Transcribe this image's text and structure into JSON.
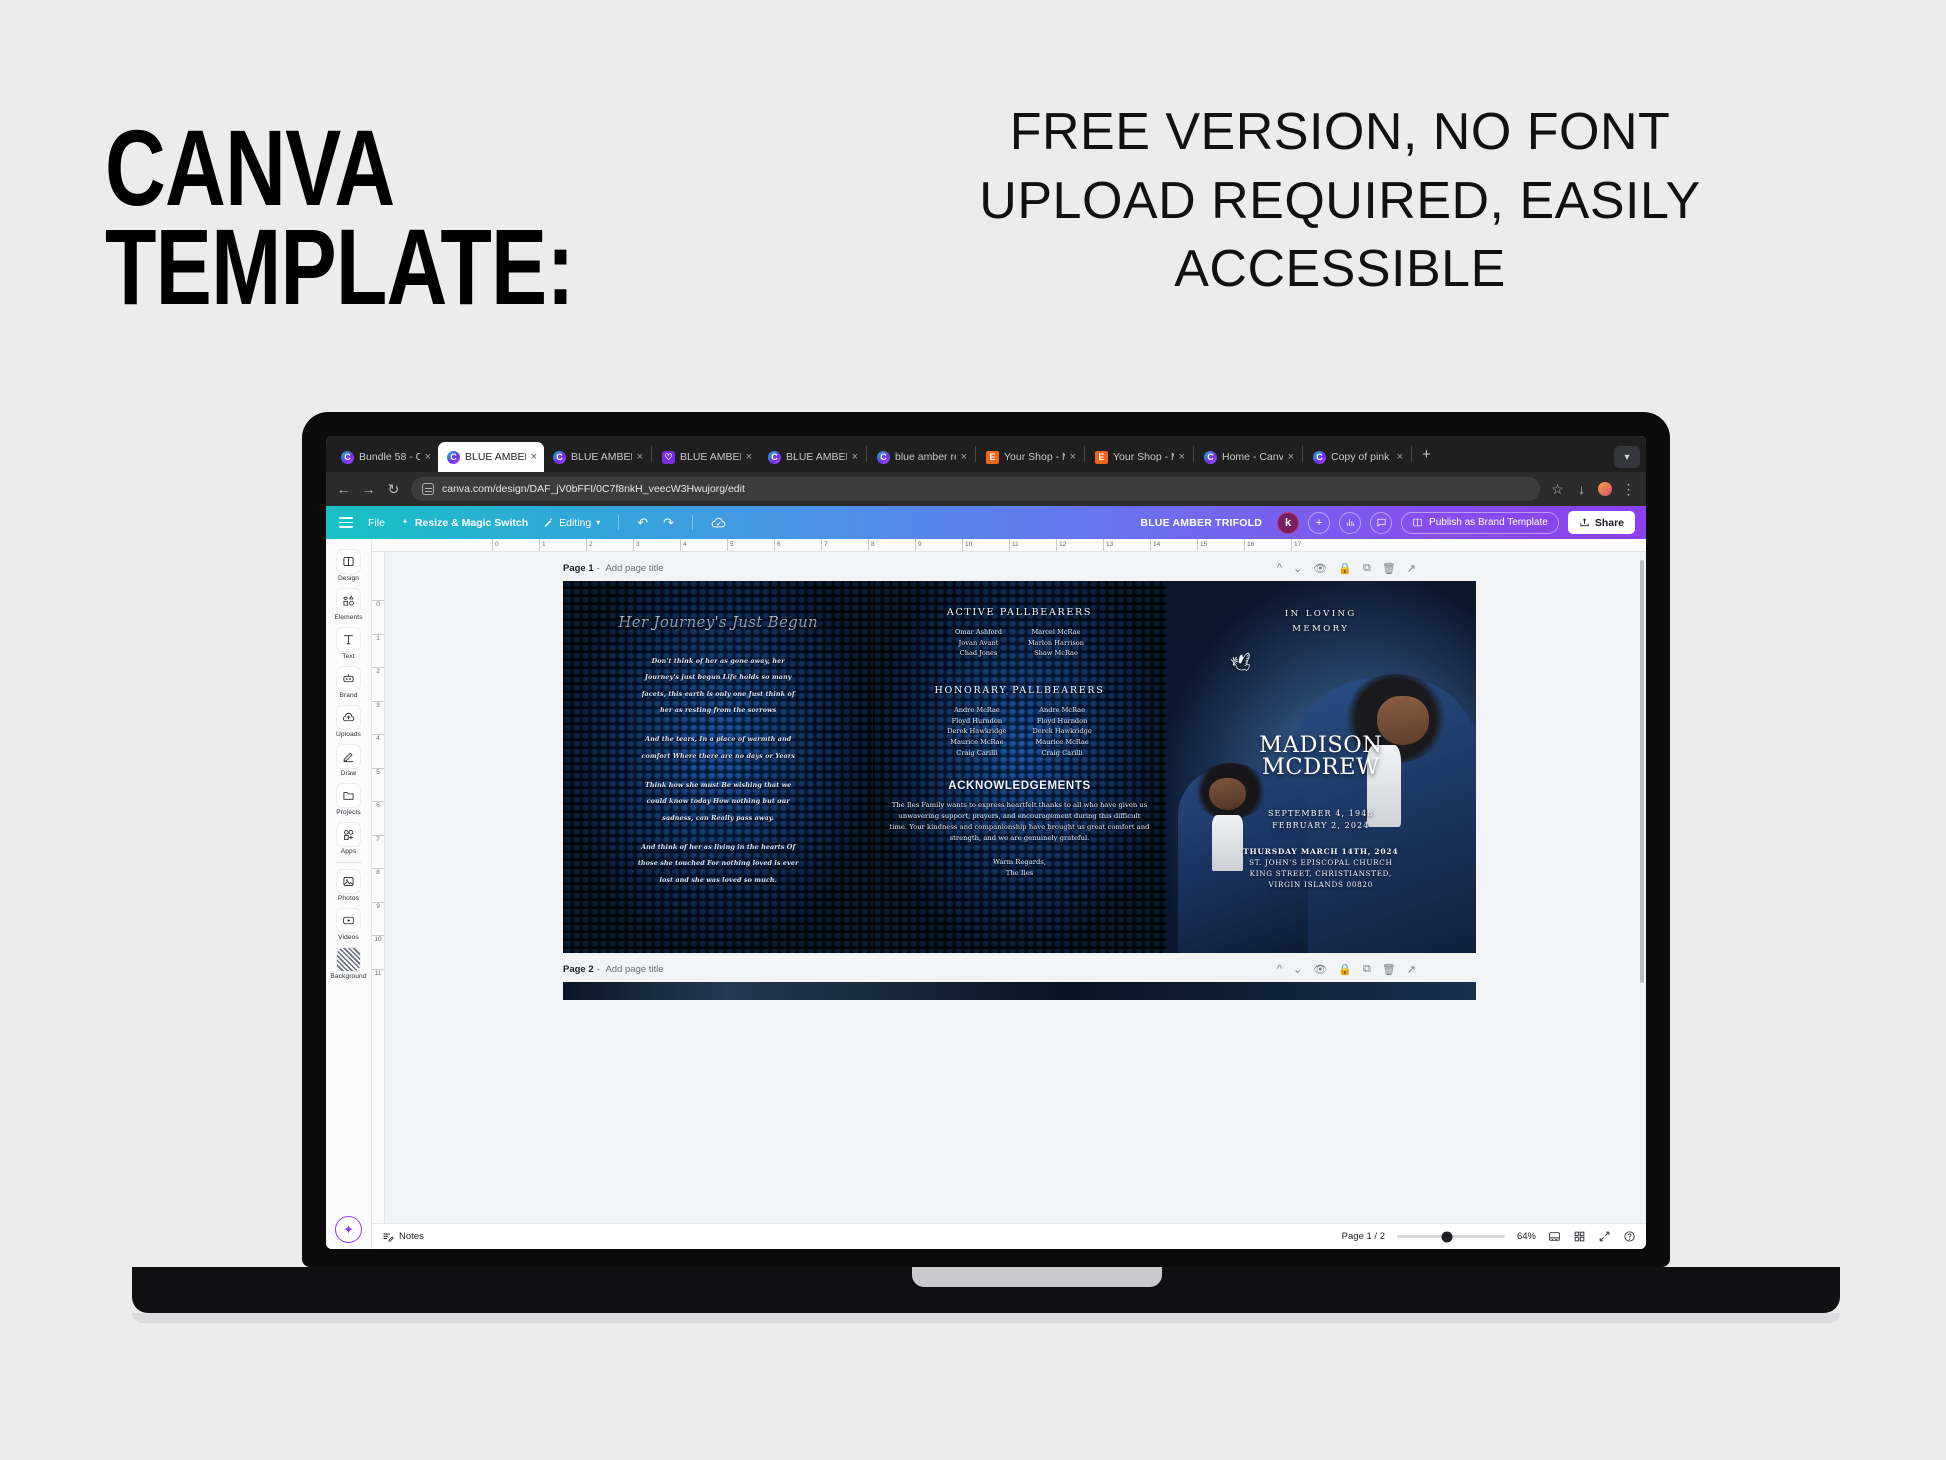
{
  "promo": {
    "headline": "CANVA TEMPLATE:",
    "subheadline": "FREE VERSION, NO FONT UPLOAD REQUIRED, EASILY ACCESSIBLE"
  },
  "browser": {
    "tabs": [
      {
        "title": "Bundle 58 - C",
        "favicon": "canva-icon",
        "active": false
      },
      {
        "title": "BLUE AMBER T",
        "favicon": "canva-icon",
        "active": true
      },
      {
        "title": "BLUE AMBER",
        "favicon": "canva-icon",
        "active": false
      },
      {
        "title": "BLUE AMBER",
        "favicon": "bookmark-icon",
        "active": false
      },
      {
        "title": "BLUE AMBER",
        "favicon": "canva-icon",
        "active": false
      },
      {
        "title": "blue amber re",
        "favicon": "canva-icon",
        "active": false
      },
      {
        "title": "Your Shop - M",
        "favicon": "etsy-icon",
        "active": false
      },
      {
        "title": "Your Shop - M",
        "favicon": "etsy-icon",
        "active": false
      },
      {
        "title": "Home - Canva",
        "favicon": "canva-icon",
        "active": false
      },
      {
        "title": "Copy of pink o",
        "favicon": "canva-icon",
        "active": false
      }
    ],
    "new_tab_label": "+",
    "tab_close_label": "×",
    "url": "canva.com/design/DAF_jV0bFFI/0C7f8nkH_veecW3Hwujorg/edit",
    "back_label": "←",
    "forward_label": "→",
    "reload_label": "↻"
  },
  "canva_toolbar": {
    "file_label": "File",
    "resize_label": "Resize & Magic Switch",
    "editing_label": "Editing",
    "doc_title": "BLUE AMBER TRIFOLD",
    "avatar_initial": "k",
    "add_collaborator_label": "+",
    "publish_label": "Publish as Brand Template",
    "share_label": "Share"
  },
  "sidebar": {
    "items": [
      {
        "label": "Design",
        "icon": "design-icon"
      },
      {
        "label": "Elements",
        "icon": "elements-icon"
      },
      {
        "label": "Text",
        "icon": "text-icon"
      },
      {
        "label": "Brand",
        "icon": "brand-icon"
      },
      {
        "label": "Uploads",
        "icon": "uploads-icon"
      },
      {
        "label": "Draw",
        "icon": "draw-icon"
      },
      {
        "label": "Projects",
        "icon": "projects-icon"
      },
      {
        "label": "Apps",
        "icon": "apps-icon"
      },
      {
        "label": "Photos",
        "icon": "photos-icon"
      },
      {
        "label": "Videos",
        "icon": "videos-icon"
      },
      {
        "label": "Background",
        "icon": "background-icon"
      }
    ],
    "magic_button": "magic-studio-icon"
  },
  "ruler": {
    "h_ticks": [
      "0",
      "1",
      "2",
      "3",
      "4",
      "5",
      "6",
      "7",
      "8",
      "9",
      "10",
      "11",
      "12",
      "13",
      "14",
      "15",
      "16",
      "17"
    ],
    "v_ticks": [
      "0",
      "1",
      "2",
      "3",
      "4",
      "5",
      "6",
      "7",
      "8",
      "9",
      "10",
      "11"
    ]
  },
  "pages": [
    {
      "label": "Page 1",
      "title_placeholder": "Add page title"
    },
    {
      "label": "Page 2",
      "title_placeholder": "Add page title"
    }
  ],
  "page_tools": [
    "move-up-icon",
    "move-down-icon",
    "hide-page-icon",
    "lock-icon",
    "duplicate-icon",
    "delete-icon",
    "expand-icon"
  ],
  "design": {
    "panel_left": {
      "script_title": "Her Journey's Just Begun",
      "poem_stanza_1": [
        "Don't think of her as gone away, her",
        "Journey's just begun Life holds so many",
        "facets, this earth is only one Just think of",
        "her as resting from the sorrows"
      ],
      "poem_stanza_2": [
        "And the tears, In a place of warmth and",
        "comfort Where there are no days or Years",
        "Think how she must Be wishing that we",
        "could know today How nothing but our",
        "sadness, can Really pass away."
      ],
      "poem_stanza_3": [
        "And think of her as living in the hearts Of",
        "those she touched For nothing loved is ever",
        "lost and she was loved so much."
      ]
    },
    "panel_middle": {
      "active_title": "ACTIVE PALLBEARERS",
      "active_left": [
        "Omar Ashford",
        "Jovan Avant",
        "Chad Jones"
      ],
      "active_right": [
        "Marcel McRae",
        "Marlon Harrison",
        "Shaw McRae"
      ],
      "honorary_title": "HONORARY PALLBEARERS",
      "honorary_left": [
        "Andre McRae",
        "Floyd Hurndon",
        "Derek Hawkridge",
        "Maurice McRae",
        "Craig Carilli"
      ],
      "honorary_right": [
        "Andre McRae",
        "Floyd Hurndon",
        "Derek Hawkridge",
        "Maurice McRae",
        "Craig Carilli"
      ],
      "ack_title": "ACKNOWLEDGEMENTS",
      "ack_body": "The Iles Family wants to express heartfelt thanks to all who have given us unwavering support, prayers, and encouragement during this difficult time. Your kindness and companionship have brought us great comfort and strength, and we are genuinely grateful.",
      "ack_warm": "Warm Regards,",
      "ack_signature": "The Iles"
    },
    "panel_right": {
      "in_loving": "IN LOVING",
      "memory": "MEMORY",
      "name_first": "MADISON",
      "name_last": "MCDREW",
      "date_birth": "SEPTEMBER 4, 1948",
      "date_death": "FEBRUARY 2, 2024",
      "service_day": "THURSDAY MARCH 14TH, 2024",
      "service_venue": "ST. JOHN'S EPISCOPAL CHURCH",
      "service_street": "KING STREET, CHRISTIANSTED,",
      "service_region": "VIRGIN ISLANDS 00820"
    }
  },
  "status_bar": {
    "notes_label": "Notes",
    "page_indicator": "Page 1 / 2",
    "zoom_level": "64%",
    "view_icons": [
      "page-view-icon",
      "grid-view-icon",
      "fullscreen-icon",
      "help-icon"
    ]
  },
  "colors": {
    "canva_gradient_start": "#18c2c4",
    "canva_gradient_end": "#8a3ff0",
    "magic_purple": "#8b3dff",
    "etsy_orange": "#f1641e",
    "page_bg": "#ececec"
  }
}
